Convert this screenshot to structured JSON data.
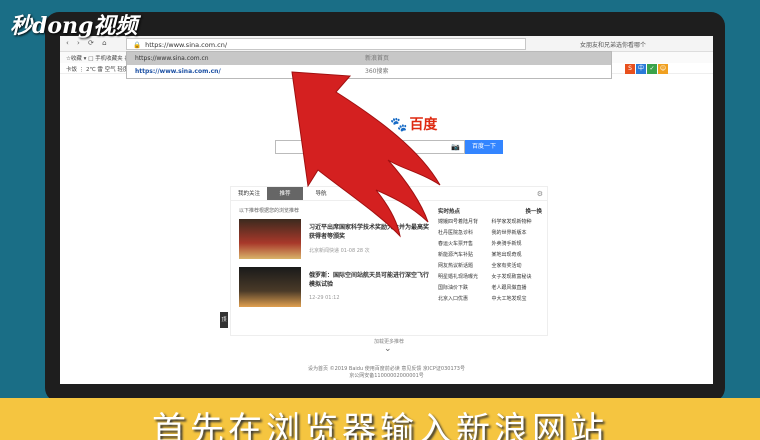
{
  "watermark": "秒dong视频",
  "browser": {
    "nav_glyphs": "‹ › ⟳ ⌂",
    "address_value": "https://www.sina.com.cn/",
    "right_text": "女朋友和兄弟选你看哪个",
    "bookmarks": "☆收藏 ▾   □ 手机收藏夹   谷歌 ▾",
    "favrow": "卡饭 ⋮  2℃ 雷 空气 轻度 ▾"
  },
  "dropdown": [
    {
      "url": "https://www.sina.com.cn",
      "source": "新浪首页"
    },
    {
      "url": "https://www.sina.com.cn/",
      "source": "360搜索"
    }
  ],
  "page": {
    "logo": "百度",
    "search_button": "百度一下",
    "tabs": [
      "我的关注",
      "推荐",
      "导航"
    ],
    "note": "以下推荐根据您的浏览推荐",
    "news": [
      {
        "title": "习近平出席国家科学技术奖励大会并为最高奖获得者等颁奖",
        "meta": "北京新闻快递 01-08 28 次"
      },
      {
        "title": "俄罗斯：国际空间站航天员可能进行深空飞行模拟试验",
        "meta": "12-29 01:12"
      }
    ],
    "hot_title": "实时热点",
    "hot_refresh": "换一换",
    "hot_items": [
      "嫦娥四号着陆月背",
      "科学家发现新物种",
      "杜丹医院急诊科",
      "我的世界新版本",
      "春运火车票开售",
      "外卖骑手新规",
      "新能源汽车补贴",
      "某地出现奇观",
      "网友热议新话题",
      "全家有奖活动",
      "明星婚礼现场曝光",
      "女子发现致富秘诀",
      "国际油价下跌",
      "老人跟风做直播",
      "北京入口优惠",
      "中大工地发现宝"
    ],
    "more": "加载更多推荐",
    "footer_line1": "设为首页 ©2019 Baidu 使用百度前必读 意见反馈 京ICP证030173号",
    "footer_line2": "京公网安备11000002000001号",
    "side_tab": "顶"
  },
  "caption": "首先在浏览器输入新浪网站",
  "colors": {
    "arrow": "#d42020",
    "button": "#3385ff",
    "caption_bar": "#f5c540"
  }
}
